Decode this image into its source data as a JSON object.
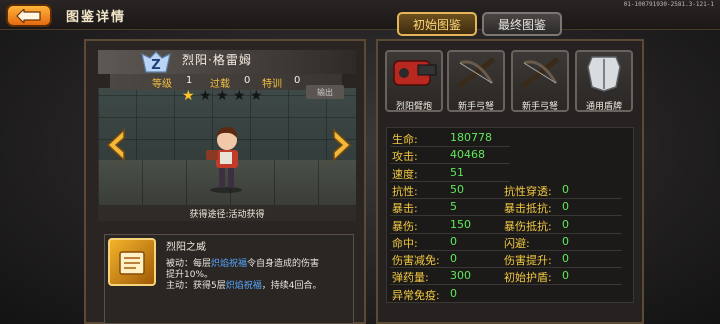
{
  "header": {
    "title": "图鉴详情",
    "build_id": "01-100791930-2581.3-121-1",
    "tabs": [
      {
        "label": "初始图鉴",
        "active": true
      },
      {
        "label": "最终图鉴",
        "active": false
      }
    ]
  },
  "hero": {
    "name": "烈阳·格雷姆",
    "rank_letter": "Z",
    "stats": [
      {
        "label": "等级",
        "value": "1"
      },
      {
        "label": "过载",
        "value": "0"
      },
      {
        "label": "特训",
        "value": "0"
      }
    ],
    "stars_filled": 1,
    "stars_total": 5,
    "output_badge": "输出",
    "acquire": "获得途径:活动获得"
  },
  "skill": {
    "title": "烈阳之威",
    "line1_a": "被动：每层",
    "line1_hl": "炽焰祝福",
    "line1_b": "令自身造成的伤害",
    "line2": "提升10%。",
    "line3_a": "主动：获得5层",
    "line3_hl": "炽焰祝福",
    "line3_b": "，持续4回合。"
  },
  "equipment": [
    {
      "label": "烈阳臂炮",
      "icon": "arm-cannon-icon"
    },
    {
      "label": "新手弓弩",
      "icon": "crossbow-icon"
    },
    {
      "label": "新手弓弩",
      "icon": "crossbow-icon"
    },
    {
      "label": "通用盾牌",
      "icon": "shield-icon"
    }
  ],
  "attributes": {
    "left": [
      {
        "label": "生命:",
        "value": "180778"
      },
      {
        "label": "攻击:",
        "value": "40468"
      },
      {
        "label": "速度:",
        "value": "51"
      },
      {
        "label": "抗性:",
        "value": "50"
      },
      {
        "label": "暴击:",
        "value": "5"
      },
      {
        "label": "暴伤:",
        "value": "150"
      },
      {
        "label": "命中:",
        "value": "0"
      },
      {
        "label": "伤害减免:",
        "value": "0"
      },
      {
        "label": "弹药量:",
        "value": "300"
      },
      {
        "label": "异常免疫:",
        "value": "0"
      }
    ],
    "right": [
      {
        "label": "抗性穿透:",
        "value": "0"
      },
      {
        "label": "暴击抵抗:",
        "value": "0"
      },
      {
        "label": "暴伤抵抗:",
        "value": "0"
      },
      {
        "label": "闪避:",
        "value": "0"
      },
      {
        "label": "伤害提升:",
        "value": "0"
      },
      {
        "label": "初始护盾:",
        "value": "0"
      }
    ]
  },
  "colors": {
    "accent": "#f0c040",
    "value_green": "#5ee85a",
    "skill_highlight": "#56a8ff"
  }
}
